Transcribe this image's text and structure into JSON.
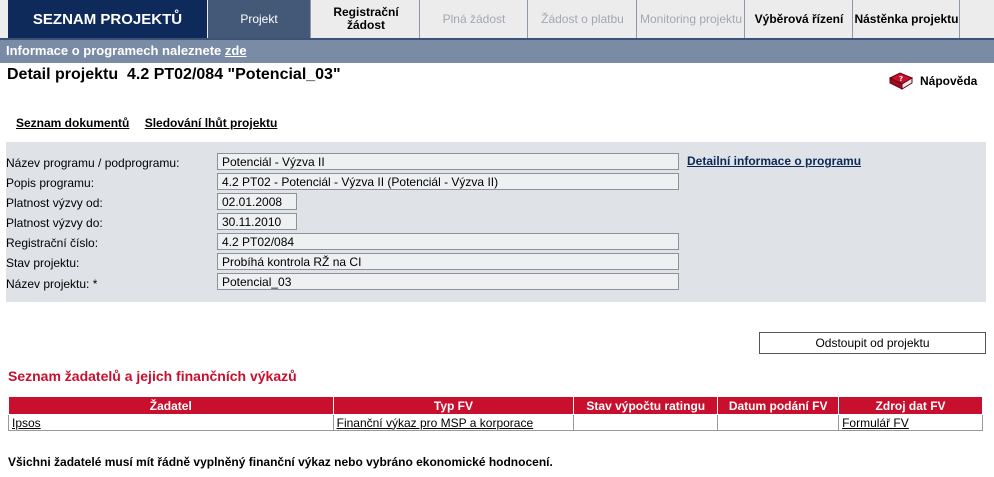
{
  "nav": {
    "brand": "SEZNAM PROJEKTŮ",
    "tabs": [
      {
        "label": "Projekt"
      },
      {
        "label": "Registrační žádost"
      },
      {
        "label": "Plná žádost"
      },
      {
        "label": "Žádost o platbu"
      },
      {
        "label": "Monitoring projektu"
      },
      {
        "label": "Výběrová řízení"
      },
      {
        "label": "Nástěnka projektu"
      }
    ]
  },
  "info_bar": {
    "text": "Informace o programech naleznete",
    "link": "zde"
  },
  "header": {
    "title": "Detail projektu  4.2 PT02/084 \"Potencial_03\"",
    "help_label": "Nápověda"
  },
  "links": {
    "documents": "Seznam dokumentů",
    "deadlines": "Sledování lhůt projektu"
  },
  "form": {
    "program": {
      "label": "Název programu / podprogramu:",
      "value": "Potenciál - Výzva II"
    },
    "program_desc": {
      "label": "Popis programu:",
      "value": "4.2 PT02 - Potenciál - Výzva II (Potenciál - Výzva II)"
    },
    "valid_from": {
      "label": "Platnost výzvy od:",
      "value": "02.01.2008"
    },
    "valid_to": {
      "label": "Platnost výzvy do:",
      "value": "30.11.2010"
    },
    "reg_number": {
      "label": "Registrační číslo:",
      "value": "4.2 PT02/084"
    },
    "status": {
      "label": "Stav projektu:",
      "value": "Probíhá kontrola RŽ na CI"
    },
    "name": {
      "label": "Název projektu: *",
      "value": "Potencial_03"
    },
    "detail_link": "Detailní informace o programu"
  },
  "withdraw_button": "Odstoupit od projektu",
  "applicants": {
    "title": "Seznam žadatelů a jejich finančních výkazů",
    "headers": [
      "Žadatel",
      "Typ FV",
      "Stav výpočtu ratingu",
      "Datum podání FV",
      "Zdroj dat FV"
    ],
    "rows": [
      [
        "Ipsos",
        "Finanční výkaz pro MSP a korporace",
        "",
        "",
        "Formulář FV"
      ]
    ]
  },
  "footnote": "Všichni žadatelé musí mít řádně vyplněný finanční výkaz nebo vybráno ekonomické hodnocení.",
  "colors": {
    "brand": "#0e2a5a",
    "accent_red": "#c8102e",
    "nav_bar": "#7a8ba6"
  }
}
